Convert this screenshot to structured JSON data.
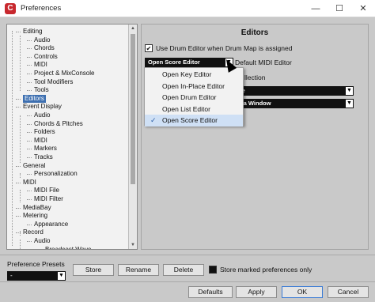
{
  "window": {
    "title": "Preferences",
    "icon": "cubase-icon",
    "controls": [
      "—",
      "☐",
      "✕"
    ]
  },
  "tree": {
    "items": [
      {
        "label": "Editing",
        "level": 0
      },
      {
        "label": "Audio",
        "level": 1
      },
      {
        "label": "Chords",
        "level": 1
      },
      {
        "label": "Controls",
        "level": 1
      },
      {
        "label": "MIDI",
        "level": 1
      },
      {
        "label": "Project & MixConsole",
        "level": 1
      },
      {
        "label": "Tool Modifiers",
        "level": 1
      },
      {
        "label": "Tools",
        "level": 1
      },
      {
        "label": "Editors",
        "level": 0,
        "selected": true
      },
      {
        "label": "Event Display",
        "level": 0
      },
      {
        "label": "Audio",
        "level": 1
      },
      {
        "label": "Chords & Pitches",
        "level": 1
      },
      {
        "label": "Folders",
        "level": 1
      },
      {
        "label": "MIDI",
        "level": 1
      },
      {
        "label": "Markers",
        "level": 1
      },
      {
        "label": "Tracks",
        "level": 1
      },
      {
        "label": "General",
        "level": 0
      },
      {
        "label": "Personalization",
        "level": 1
      },
      {
        "label": "MIDI",
        "level": 0
      },
      {
        "label": "MIDI File",
        "level": 1
      },
      {
        "label": "MIDI Filter",
        "level": 1
      },
      {
        "label": "MediaBay",
        "level": 0
      },
      {
        "label": "Metering",
        "level": 0
      },
      {
        "label": "Appearance",
        "level": 1
      },
      {
        "label": "Record",
        "level": 0
      },
      {
        "label": "Audio",
        "level": 1
      },
      {
        "label": "Broadcast Wave",
        "level": 2
      }
    ]
  },
  "panel": {
    "title": "Editors",
    "drum_editor": {
      "label": "Use Drum Editor when Drum Map is assigned",
      "checked": true
    },
    "default_editor": {
      "value": "Open Score Editor",
      "label": "Default MIDI Editor"
    },
    "partial_label": "llection",
    "dropdown2": {
      "value": "ne"
    },
    "dropdown3": {
      "value": "n a Window"
    }
  },
  "popup": {
    "items": [
      {
        "label": "Open Key Editor",
        "selected": false
      },
      {
        "label": "Open In-Place Editor",
        "selected": false
      },
      {
        "label": "Open Drum Editor",
        "selected": false
      },
      {
        "label": "Open List Editor",
        "selected": false
      },
      {
        "label": "Open Score Editor",
        "selected": true
      }
    ],
    "check_glyph": "✓"
  },
  "presets": {
    "label": "Preference Presets",
    "value": "-",
    "store": "Store",
    "rename": "Rename",
    "delete": "Delete",
    "store_marked_label": "Store marked preferences only",
    "store_marked_checked": false
  },
  "footer": {
    "defaults": "Defaults",
    "apply": "Apply",
    "ok": "OK",
    "cancel": "Cancel"
  },
  "colors": {
    "selection": "#3d6fb0",
    "menu_highlight": "#cfe0f5",
    "brand": "#c8282e"
  }
}
